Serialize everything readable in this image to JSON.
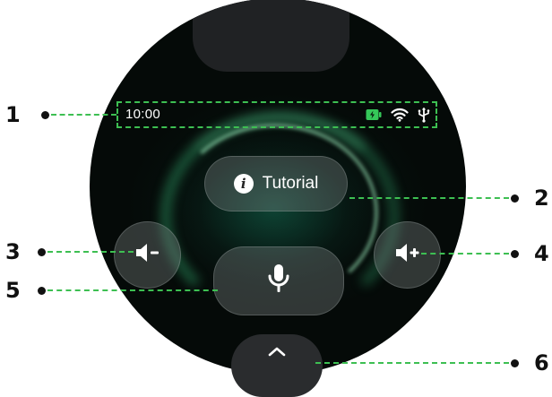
{
  "status_bar": {
    "time": "10:00",
    "icons": [
      "battery-charging-icon",
      "wifi-icon",
      "usb-icon"
    ]
  },
  "tutorial_button": {
    "label": "Tutorial",
    "icon": "info-icon"
  },
  "buttons": {
    "volume_down": "volume-down-icon",
    "volume_up": "volume-up-icon",
    "microphone": "microphone-icon",
    "swipe_up": "chevron-up-icon"
  },
  "callouts": [
    "1",
    "2",
    "3",
    "4",
    "5",
    "6"
  ],
  "colors": {
    "callout_line": "#3dbf52",
    "watch_background": "#050a08",
    "accent_glow": "#3fd08a",
    "battery": "#35c759"
  }
}
